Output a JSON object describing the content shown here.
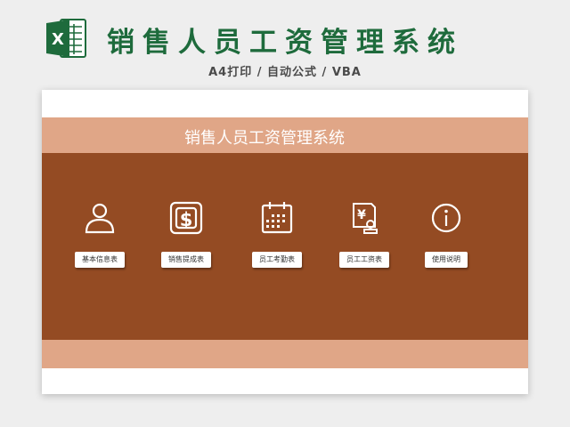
{
  "header": {
    "title": "销售人员工资管理系统",
    "subtitle": "A4打印 / 自动公式 / VBA",
    "app_icon": "excel-icon",
    "app_icon_letter": "X"
  },
  "sheet": {
    "banner_title": "销售人员工资管理系统",
    "tiles": [
      {
        "icon": "person-icon",
        "label": "基本信息表"
      },
      {
        "icon": "dollar-icon",
        "label": "销售提成表"
      },
      {
        "icon": "calendar-icon",
        "label": "员工考勤表"
      },
      {
        "icon": "payslip-icon",
        "label": "员工工资表"
      },
      {
        "icon": "info-icon",
        "label": "使用说明"
      }
    ]
  },
  "colors": {
    "brand_green": "#1e6b3c",
    "band_light": "#e0a687",
    "panel_brown": "#944b23"
  }
}
